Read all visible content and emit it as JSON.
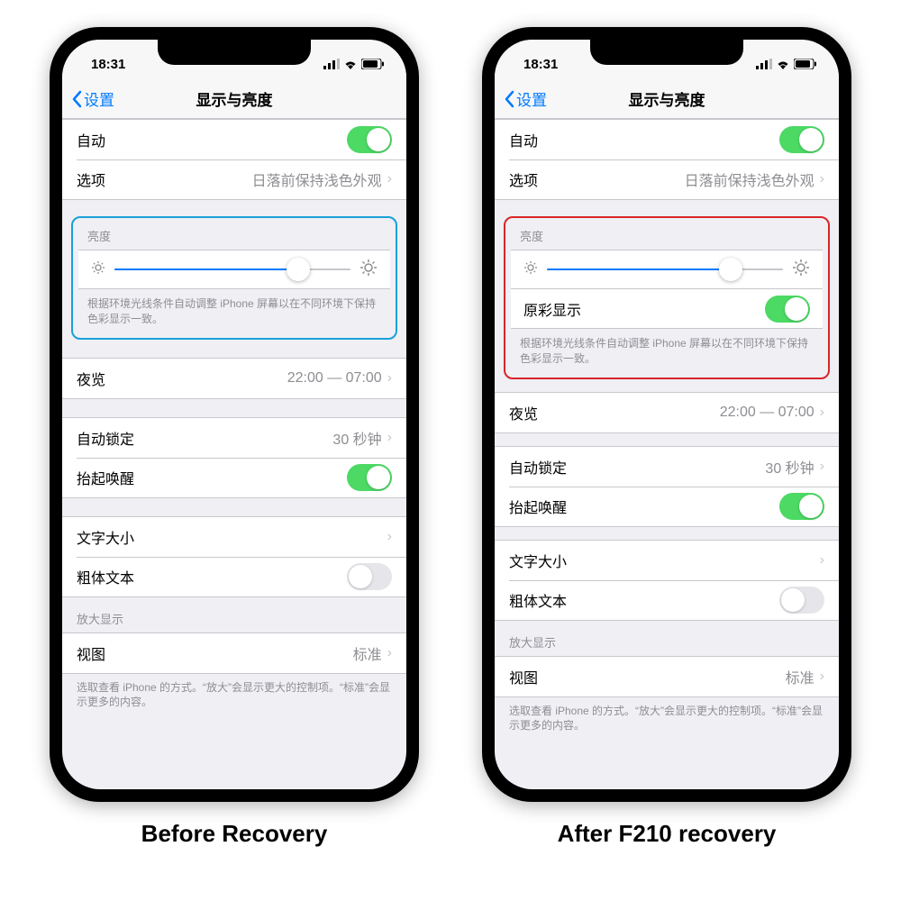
{
  "statusbar": {
    "time": "18:31"
  },
  "navbar": {
    "back": "设置",
    "title": "显示与亮度"
  },
  "rows": {
    "auto": "自动",
    "options": {
      "label": "选项",
      "value": "日落前保持浅色外观"
    },
    "brightness_header": "亮度",
    "truetone": "原彩显示",
    "brightness_footer": "根据环境光线条件自动调整 iPhone 屏幕以在不同环境下保持色彩显示一致。",
    "night": {
      "label": "夜览",
      "value": "22:00 — 07:00"
    },
    "autolock": {
      "label": "自动锁定",
      "value": "30 秒钟"
    },
    "raise": "抬起唤醒",
    "textsize": "文字大小",
    "bold": "粗体文本",
    "zoom_header": "放大显示",
    "view": {
      "label": "视图",
      "value": "标准"
    },
    "zoom_footer": "选取查看 iPhone 的方式。“放大”会显示更大的控制项。“标准”会显示更多的内容。"
  },
  "slider": {
    "fillPercent": 78
  },
  "captions": {
    "before": "Before Recovery",
    "after": "After F210 recovery"
  },
  "colors": {
    "highlightBefore": "#1aa0d8",
    "highlightAfter": "#d9252a"
  }
}
